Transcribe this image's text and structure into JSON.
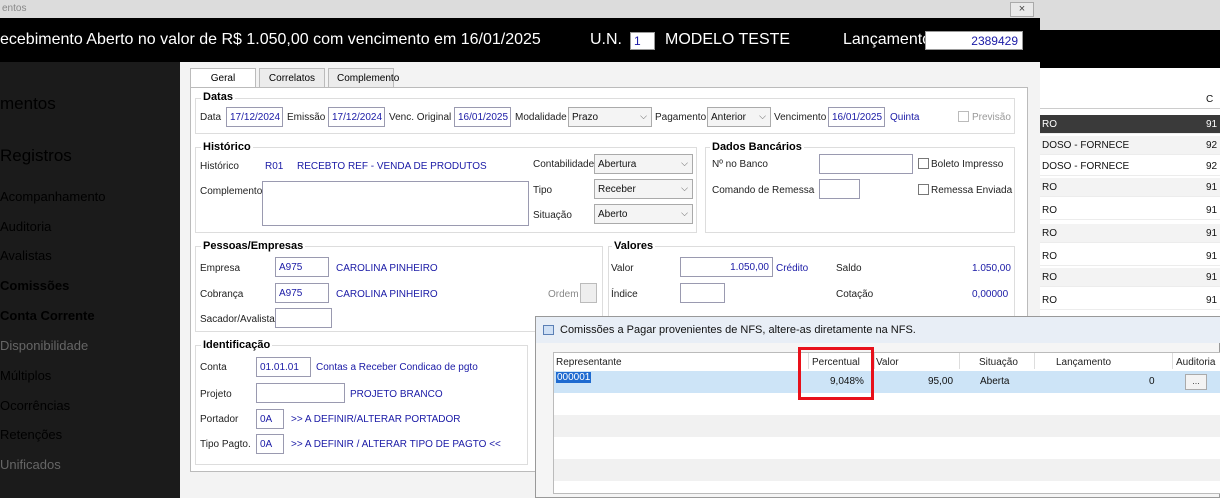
{
  "window": {
    "title_fragment": "entos",
    "close_glyph": "×"
  },
  "header": {
    "title": "ecebimento Aberto no valor de R$ 1.050,00 com vencimento em 16/01/2025",
    "un_label": "U.N.",
    "un_value": "1",
    "un_name": "MODELO TESTE",
    "lancamento_label": "Lançamento",
    "lancamento_value": "2389429"
  },
  "sidebar": {
    "items": [
      {
        "label": "mentos"
      },
      {
        "label": "Registros"
      },
      {
        "label": "Acompanhamento"
      },
      {
        "label": "Auditoria"
      },
      {
        "label": "Avalistas"
      },
      {
        "label": "Comissões"
      },
      {
        "label": "Conta Corrente"
      },
      {
        "label": "Disponibilidade"
      },
      {
        "label": "Múltiplos"
      },
      {
        "label": "Ocorrências"
      },
      {
        "label": "Retenções"
      },
      {
        "label": "Unificados"
      }
    ]
  },
  "tabs": [
    {
      "label": "Geral"
    },
    {
      "label": "Correlatos"
    },
    {
      "label": "Complemento"
    }
  ],
  "datas": {
    "title": "Datas",
    "data_label": "Data",
    "data_value": "17/12/2024",
    "emissao_label": "Emissão",
    "emissao_value": "17/12/2024",
    "venc_orig_label": "Venc. Original",
    "venc_orig_value": "16/01/2025",
    "modalidade_label": "Modalidade",
    "modalidade_value": "Prazo",
    "pagamento_label": "Pagamento",
    "pagamento_value": "Anterior",
    "vencimento_label": "Vencimento",
    "vencimento_value": "16/01/2025",
    "vencimento_day": "Quinta",
    "previsao_label": "Previsão"
  },
  "historico": {
    "title": "Histórico",
    "historico_label": "Histórico",
    "historico_code": "R01",
    "historico_text": "RECEBTO REF - VENDA DE PRODUTOS",
    "complemento_label": "Complemento",
    "contabilidade_label": "Contabilidade",
    "contabilidade_value": "Abertura",
    "tipo_label": "Tipo",
    "tipo_value": "Receber",
    "situacao_label": "Situação",
    "situacao_value": "Aberto"
  },
  "bancarios": {
    "title": "Dados Bancários",
    "nobanco_label": "Nº no Banco",
    "comando_label": "Comando de Remessa",
    "boleto_label": "Boleto Impresso",
    "remessa_label": "Remessa Enviada"
  },
  "pessoas": {
    "title": "Pessoas/Empresas",
    "empresa_label": "Empresa",
    "empresa_code": "A975",
    "empresa_name": "CAROLINA PINHEIRO",
    "cobranca_label": "Cobrança",
    "cobranca_code": "A975",
    "cobranca_name": "CAROLINA PINHEIRO",
    "ordem_label": "Ordem",
    "sacador_label": "Sacador/Avalista"
  },
  "valores": {
    "title": "Valores",
    "valor_label": "Valor",
    "valor_value": "1.050,00",
    "valor_tipo": "Crédito",
    "saldo_label": "Saldo",
    "saldo_value": "1.050,00",
    "indice_label": "Índice",
    "cotacao_label": "Cotação",
    "cotacao_value": "0,00000"
  },
  "identificacao": {
    "title": "Identificação",
    "conta_label": "Conta",
    "conta_code": "01.01.01",
    "conta_text": "Contas a Receber Condicao de pgto",
    "projeto_label": "Projeto",
    "projeto_text": "PROJETO BRANCO",
    "portador_label": "Portador",
    "portador_code": "0A",
    "portador_text": ">> A DEFINIR/ALTERAR PORTADOR",
    "tipopagto_label": "Tipo Pagto.",
    "tipopagto_code": "0A",
    "tipopagto_text": ">> A DEFINIR / ALTERAR TIPO DE PAGTO <<"
  },
  "right_list": {
    "header_col2": "C",
    "rows": [
      {
        "c1": "RO",
        "c2": "91"
      },
      {
        "c1": "DOSO - FORNECE",
        "c2": "92"
      },
      {
        "c1": "DOSO - FORNECE",
        "c2": "92"
      },
      {
        "c1": "RO",
        "c2": "91"
      },
      {
        "c1": "RO",
        "c2": "91"
      },
      {
        "c1": "RO",
        "c2": "91"
      },
      {
        "c1": "RO",
        "c2": "91"
      },
      {
        "c1": "RO",
        "c2": "91"
      },
      {
        "c1": "RO",
        "c2": "91"
      }
    ]
  },
  "dialog": {
    "title": "Comissões a Pagar provenientes de NFS, altere-as diretamente na NFS.",
    "columns": [
      "Representante",
      "Percentual",
      "Valor",
      "Situação",
      "Lançamento",
      "Auditoria"
    ],
    "rows": [
      {
        "representante": "000001",
        "percentual": "9,048%",
        "valor": "95,00",
        "situacao": "Aberta",
        "lancamento": "0",
        "auditoria": "..."
      }
    ]
  },
  "colors": {
    "highlight": "#e8101a",
    "link_blue": "#1a1aa6",
    "selection": "#cde4f7"
  }
}
